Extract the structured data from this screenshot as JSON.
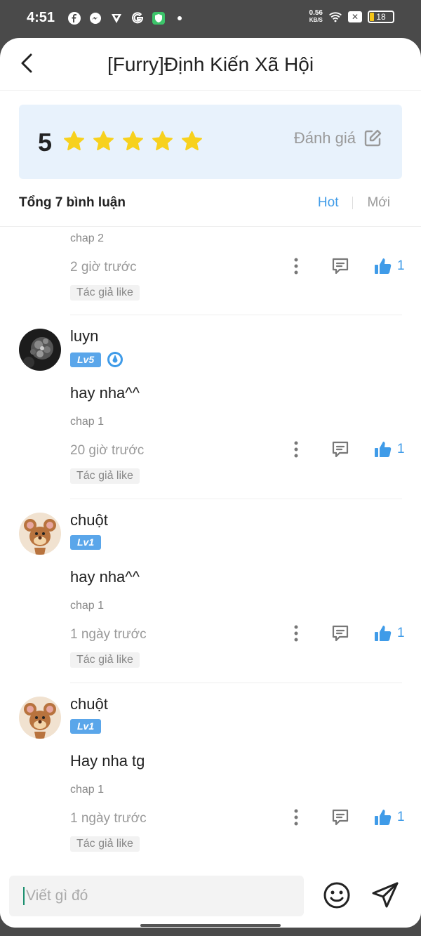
{
  "status_bar": {
    "time": "4:51",
    "speed_value": "0.56",
    "speed_unit": "KB/S",
    "battery": "18",
    "icons": [
      "facebook-icon",
      "messenger-icon",
      "vpn-icon",
      "google-icon",
      "shield-icon",
      "dot-icon",
      "wifi-icon",
      "x-icon",
      "battery-icon"
    ]
  },
  "header": {
    "title": "[Furry]Định Kiến Xã Hội",
    "back_icon": "chevron-left-icon"
  },
  "rating": {
    "score": "5",
    "stars": 5,
    "rate_label": "Đánh giá",
    "star_color": "#f7d11e"
  },
  "summary": {
    "total_label": "Tổng 7 bình luận",
    "sort_hot": "Hot",
    "sort_new": "Mới"
  },
  "comments": [
    {
      "username": "",
      "level": "",
      "text": "",
      "chap": "chap 2",
      "time": "2 giờ trước",
      "likes": "1",
      "author_like": "Tác giả like"
    },
    {
      "username": "luyn",
      "level": "Lv5",
      "text": "hay nha^^",
      "chap": "chap 1",
      "time": "20 giờ trước",
      "likes": "1",
      "author_like": "Tác giả like"
    },
    {
      "username": "chuột",
      "level": "Lv1",
      "text": "hay nha^^",
      "chap": "chap 1",
      "time": "1 ngày trước",
      "likes": "1",
      "author_like": "Tác giả like"
    },
    {
      "username": "chuột",
      "level": "Lv1",
      "text": "Hay nha tg",
      "chap": "chap 1",
      "time": "1 ngày trước",
      "likes": "1",
      "author_like": "Tác giả like"
    }
  ],
  "composer": {
    "placeholder": "Viết gì đó"
  },
  "colors": {
    "accent": "#3f9be8",
    "rating_bg": "#e8f2fc",
    "level_badge": "#5aa6ea"
  }
}
